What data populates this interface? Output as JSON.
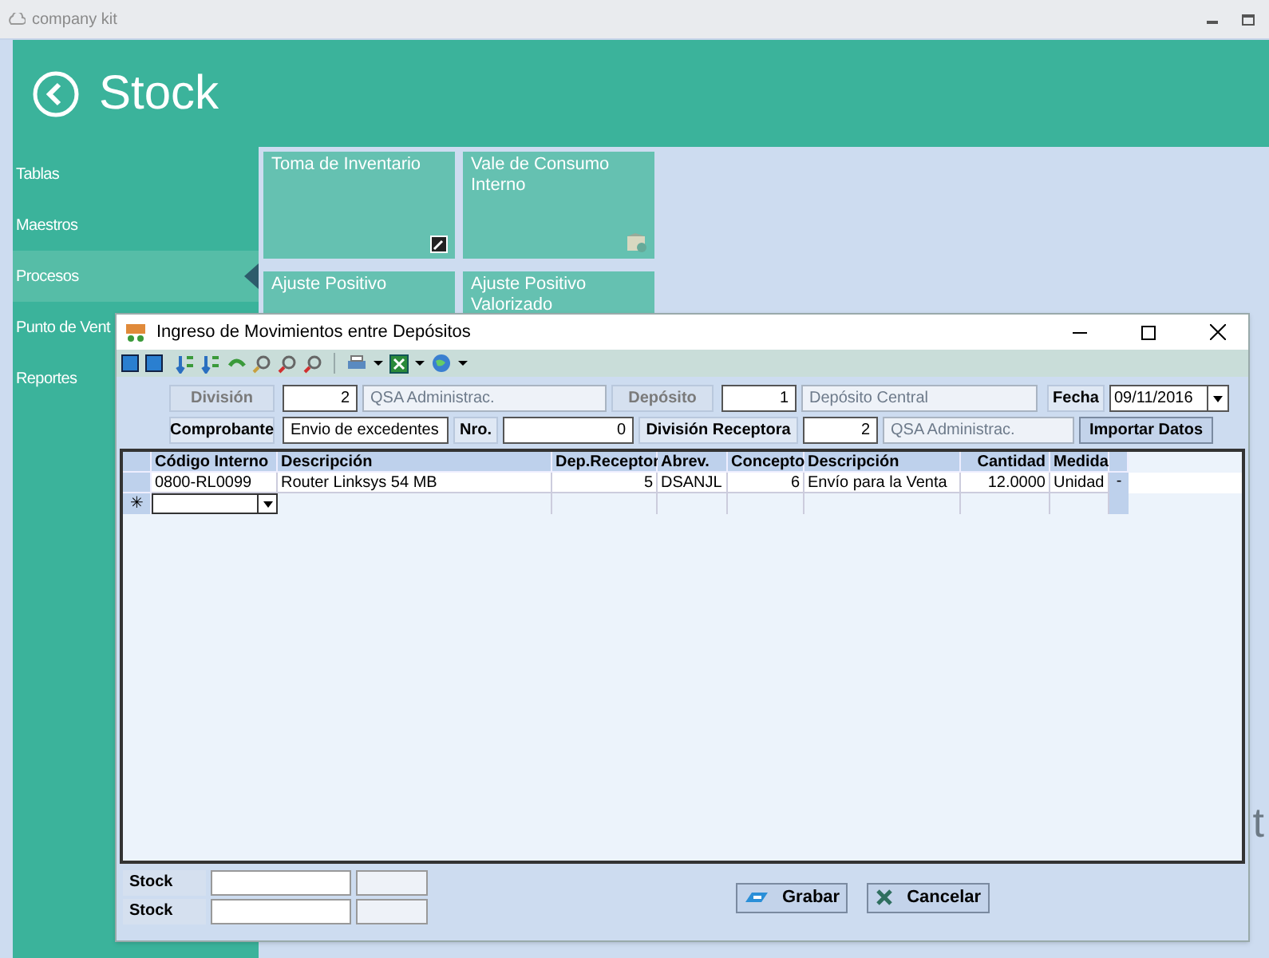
{
  "app": {
    "title": "company kit"
  },
  "header": {
    "title": "Stock"
  },
  "sidebar": {
    "items": [
      {
        "label": "Tablas",
        "selected": false
      },
      {
        "label": "Maestros",
        "selected": false
      },
      {
        "label": "Procesos",
        "selected": true
      },
      {
        "label": "Punto de Vent",
        "selected": false
      },
      {
        "label": "Reportes",
        "selected": false
      }
    ]
  },
  "tiles": [
    {
      "label": "Toma de Inventario"
    },
    {
      "label": "Vale de Consumo Interno"
    },
    {
      "label": "Ajuste Positivo"
    },
    {
      "label": "Ajuste Positivo Valorizado"
    }
  ],
  "background_text": "t",
  "dialog": {
    "title": "Ingreso de Movimientos entre Depósitos",
    "form": {
      "row_1": [
        {
          "label": "División",
          "disabled": true,
          "code": "2",
          "name": "QSA Administrac."
        },
        {
          "label": "Depósito",
          "disabled": true,
          "code": "1",
          "name": "Depósito Central"
        }
      ],
      "fecha": {
        "label": "Fecha",
        "value": "09/11/2016"
      },
      "comprobante": {
        "label": "Comprobante",
        "value": "Envio de excedentes"
      },
      "nro": {
        "label": "Nro.",
        "value": "0"
      },
      "receptora": {
        "label": "División Receptora",
        "disabled": false,
        "code": "2",
        "name": "QSA Administrac."
      },
      "import_button": "Importar Datos"
    },
    "grid": {
      "columns": [
        {
          "label": "Código Interno"
        },
        {
          "label": "Descripción"
        },
        {
          "label": "Dep.Receptor"
        },
        {
          "label": "Abrev."
        },
        {
          "label": "Concepto"
        },
        {
          "label": "Descripción"
        },
        {
          "label": "Cantidad"
        },
        {
          "label": "Medida"
        }
      ],
      "rows": [
        {
          "cells": [
            "0800-RL0099",
            "Router Linksys 54 MB",
            "5",
            "DSANJL",
            "6",
            "Envío para la Venta",
            "12.0000",
            "Unidad"
          ],
          "end": "-"
        }
      ],
      "new_row_marker": "✳"
    },
    "footer_fields": [
      {
        "label": "Stock"
      },
      {
        "label": "Stock"
      }
    ],
    "buttons": [
      {
        "label": "Grabar",
        "kind": "save"
      },
      {
        "label": "Cancelar",
        "kind": "cancel"
      }
    ]
  }
}
